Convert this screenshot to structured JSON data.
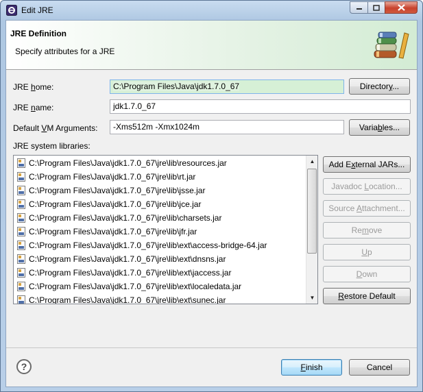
{
  "window": {
    "title": "Edit JRE"
  },
  "banner": {
    "title": "JRE Definition",
    "subtitle": "Specify attributes for a JRE"
  },
  "form": {
    "home_label": "JRE home:",
    "home_value": "C:\\Program Files\\Java\\jdk1.7.0_67",
    "directory_button": "Directory...",
    "name_label": "JRE name:",
    "name_value": "jdk1.7.0_67",
    "vm_label": "Default VM Arguments:",
    "vm_value": "-Xms512m -Xmx1024m",
    "variables_button": "Variables..."
  },
  "libraries": {
    "label": "JRE system libraries:",
    "items": [
      "C:\\Program Files\\Java\\jdk1.7.0_67\\jre\\lib\\resources.jar",
      "C:\\Program Files\\Java\\jdk1.7.0_67\\jre\\lib\\rt.jar",
      "C:\\Program Files\\Java\\jdk1.7.0_67\\jre\\lib\\jsse.jar",
      "C:\\Program Files\\Java\\jdk1.7.0_67\\jre\\lib\\jce.jar",
      "C:\\Program Files\\Java\\jdk1.7.0_67\\jre\\lib\\charsets.jar",
      "C:\\Program Files\\Java\\jdk1.7.0_67\\jre\\lib\\jfr.jar",
      "C:\\Program Files\\Java\\jdk1.7.0_67\\jre\\lib\\ext\\access-bridge-64.jar",
      "C:\\Program Files\\Java\\jdk1.7.0_67\\jre\\lib\\ext\\dnsns.jar",
      "C:\\Program Files\\Java\\jdk1.7.0_67\\jre\\lib\\ext\\jaccess.jar",
      "C:\\Program Files\\Java\\jdk1.7.0_67\\jre\\lib\\ext\\localedata.jar",
      "C:\\Program Files\\Java\\jdk1.7.0_67\\jre\\lib\\ext\\sunec.jar"
    ],
    "buttons": {
      "add_external": "Add External JARs...",
      "javadoc": "Javadoc Location...",
      "source": "Source Attachment...",
      "remove": "Remove",
      "up": "Up",
      "down": "Down",
      "restore": "Restore Default"
    }
  },
  "footer": {
    "finish": "Finish",
    "cancel": "Cancel"
  }
}
